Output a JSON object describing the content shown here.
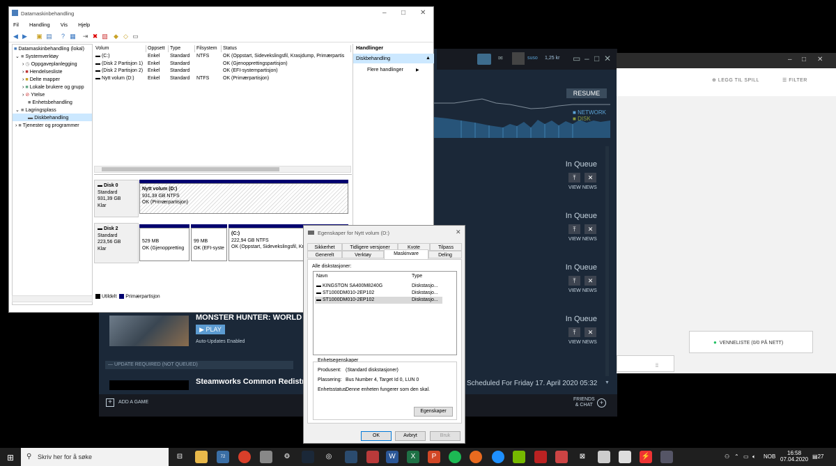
{
  "steam": {
    "user": "suso",
    "wallet": "1,25 kr",
    "resume_label": "RESUME",
    "legend_network": "NETWORK",
    "legend_disk": "DISK",
    "queue": [
      {
        "status": "In Queue",
        "view_news": "VIEW NEWS"
      },
      {
        "status": "In Queue",
        "view_news": "VIEW NEWS"
      },
      {
        "status": "In Queue",
        "view_news": "VIEW NEWS"
      },
      {
        "status": "In Queue",
        "view_news": "VIEW NEWS"
      }
    ],
    "game_title": "MONSTER HUNTER: WORLD",
    "play_label": "PLAY",
    "auto_updates": "Auto-Updates Enabled",
    "update_required": "UPDATE REQUIRED (NOT QUEUED)",
    "game2_title": "Steamworks Common Redistributa",
    "scheduled": "Scheduled For Friday 17. April 2020 05:32",
    "add_game": "ADD A GAME",
    "friends_chat_1": "FRIENDS",
    "friends_chat_2": "& CHAT"
  },
  "white_window": {
    "add_game": "LEGG TIL SPILL",
    "filter": "FILTER",
    "friends_list": "VENNELISTE (0/0 PÅ NETT)"
  },
  "cm": {
    "title": "Datamaskinbehandling",
    "menu": [
      "Fil",
      "Handling",
      "Vis",
      "Hjelp"
    ],
    "tree": [
      {
        "label": "Datamaskinbehandling (lokal)",
        "indent": 0
      },
      {
        "label": "Systemverktøy",
        "indent": 1
      },
      {
        "label": "Oppgaveplanlegging",
        "indent": 2
      },
      {
        "label": "Hendelsesliste",
        "indent": 2
      },
      {
        "label": "Delte mapper",
        "indent": 2
      },
      {
        "label": "Lokale brukere og grupp",
        "indent": 2
      },
      {
        "label": "Ytelse",
        "indent": 2
      },
      {
        "label": "Enhetsbehandling",
        "indent": 2
      },
      {
        "label": "Lagringsplass",
        "indent": 1
      },
      {
        "label": "Diskbehandling",
        "indent": 2
      },
      {
        "label": "Tjenester og programmer",
        "indent": 1
      }
    ],
    "columns": [
      "Volum",
      "Oppsett",
      "Type",
      "Filsystem",
      "Status"
    ],
    "rows": [
      [
        "(C:)",
        "Enkel",
        "Standard",
        "NTFS",
        "OK (Oppstart, Sidevekslingsfil, Krasjdump, Primærpartis"
      ],
      [
        "(Disk 2 Partisjon 1)",
        "Enkel",
        "Standard",
        "",
        "OK (Gjenopprettingspartisjon)"
      ],
      [
        "(Disk 2 Partisjon 2)",
        "Enkel",
        "Standard",
        "",
        "OK (EFI-systempartisjon)"
      ],
      [
        "Nytt volum (D:)",
        "Enkel",
        "Standard",
        "NTFS",
        "OK (Primærpartisjon)"
      ]
    ],
    "disk0": {
      "name": "Disk 0",
      "type": "Standard",
      "size": "931,39 GB",
      "state": "Klar"
    },
    "disk0_part": {
      "name": "Nytt volum (D:)",
      "size": "931,39 GB NTFS",
      "status": "OK (Primærpartisjon)"
    },
    "disk1": {
      "name": "Disk 2",
      "type": "Standard",
      "size": "223,56 GB",
      "state": "Klar"
    },
    "disk1_parts": [
      {
        "name": "",
        "size": "529 MB",
        "status": "OK (Gjenoppretting"
      },
      {
        "name": "",
        "size": "99 MB",
        "status": "OK (EFI-syste"
      },
      {
        "name": "(C:)",
        "size": "222,94 GB NTFS",
        "status": "OK (Oppstart, Sidevekslingsfil, Kr"
      }
    ],
    "legend_unalloc": "Utildelt",
    "legend_primary": "Primærpartisjon",
    "actions_header": "Handlinger",
    "actions_selected": "Diskbehandling",
    "actions_more": "Flere handlinger"
  },
  "dlg": {
    "title": "Egenskaper for Nytt volum (D:)",
    "tabs_row1": [
      "Sikkerhet",
      "Tidligere versjoner",
      "Kvote",
      "Tilpass"
    ],
    "tabs_row2": [
      "Generelt",
      "Verktøy",
      "Maskinvare",
      "Deling"
    ],
    "all_drives": "Alle diskstasjoner:",
    "col_name": "Navn",
    "col_type": "Type",
    "drives": [
      {
        "name": "KINGSTON SA400M8240G",
        "type": "Diskstasjo..."
      },
      {
        "name": "ST1000DM010-2EP102",
        "type": "Diskstasjo..."
      },
      {
        "name": "ST1000DM010-2EP102",
        "type": "Diskstasjo..."
      }
    ],
    "group_title": "Enhetsegenskaper",
    "manufacturer_label": "Produsent:",
    "manufacturer": "(Standard diskstasjoner)",
    "location_label": "Plassering:",
    "location": "Bus Number 4, Target Id 0, LUN 0",
    "status_label": "Enhetsstatus:",
    "status": "Denne enheten fungerer som den skal.",
    "properties_btn": "Egenskaper",
    "ok": "OK",
    "cancel": "Avbryt",
    "apply": "Bruk"
  },
  "taskbar": {
    "search_placeholder": "Skriv her for å søke",
    "badge": "72",
    "lang": "NOB",
    "time": "16:58",
    "date": "07.04.2020",
    "notifications": "27"
  }
}
